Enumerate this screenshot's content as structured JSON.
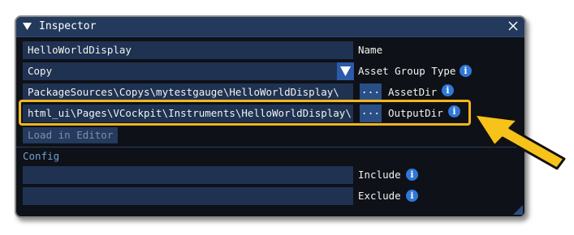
{
  "window": {
    "title": "Inspector"
  },
  "rows": {
    "name": {
      "value": "HelloWorldDisplay",
      "label": "Name"
    },
    "asset_group_type": {
      "value": "Copy",
      "label": "Asset Group Type"
    },
    "asset_dir": {
      "value": "PackageSources\\Copys\\mytestgauge\\HelloWorldDisplay\\",
      "browse_label": "...",
      "label": "AssetDir"
    },
    "output_dir": {
      "value": "html_ui\\Pages\\VCockpit\\Instruments\\HelloWorldDisplay\\",
      "browse_label": "...",
      "label": "OutputDir"
    }
  },
  "load_button": "Load in Editor",
  "config": {
    "title": "Config",
    "include": {
      "value": "",
      "label": "Include"
    },
    "exclude": {
      "value": "",
      "label": "Exclude"
    }
  },
  "info_glyph": "i",
  "colors": {
    "accent": "#2f78d8",
    "highlight": "#f2b51d",
    "field_bg": "#1f3252",
    "title_bar": "#233a5c"
  },
  "icons": [
    "collapse-arrow-icon",
    "close-icon",
    "info-icon",
    "dropdown-arrow-icon",
    "resize-grip-icon",
    "callout-arrow-icon"
  ]
}
